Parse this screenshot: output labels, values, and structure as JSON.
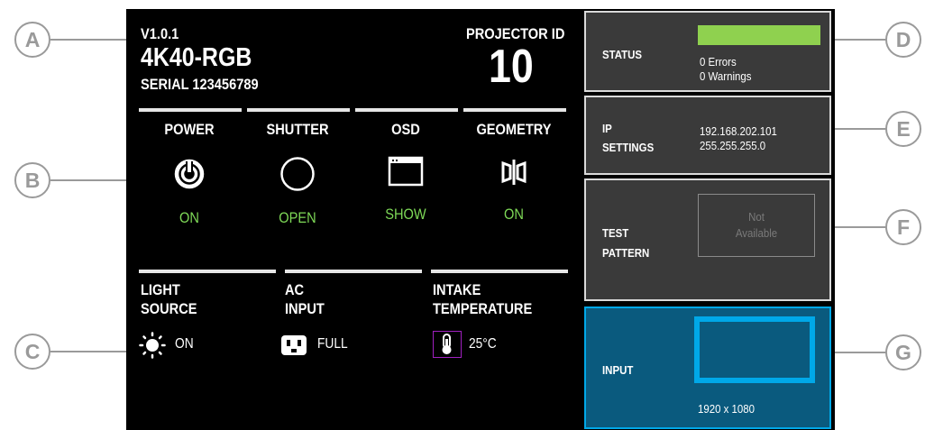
{
  "callouts": [
    "A",
    "B",
    "C",
    "D",
    "E",
    "F",
    "G"
  ],
  "device": {
    "version": "V1.0.1",
    "model": "4K40-RGB",
    "serial": "SERIAL 123456789",
    "projector_id_label": "PROJECTOR ID",
    "projector_id": "10"
  },
  "controls": [
    {
      "title": "POWER",
      "value": "ON",
      "icon": "power-icon"
    },
    {
      "title": "SHUTTER",
      "value": "OPEN",
      "icon": "shutter-icon"
    },
    {
      "title": "OSD",
      "value": "SHOW",
      "icon": "osd-window-icon"
    },
    {
      "title": "GEOMETRY",
      "value": "ON",
      "icon": "geometry-icon"
    }
  ],
  "info": [
    {
      "title_line1": "LIGHT",
      "title_line2": "SOURCE",
      "value": "ON",
      "icon": "sun-icon"
    },
    {
      "title_line1": "AC",
      "title_line2": "INPUT",
      "value": "FULL",
      "icon": "power-plug-icon"
    },
    {
      "title_line1": "INTAKE",
      "title_line2": "TEMPERATURE",
      "value": "25°C",
      "icon": "thermometer-icon"
    }
  ],
  "status": {
    "label": "STATUS",
    "errors": "0 Errors",
    "warnings": "0 Warnings",
    "bar_color": "#8fd14f"
  },
  "ip": {
    "label_line1": "IP",
    "label_line2": "SETTINGS",
    "address": "192.168.202.101",
    "mask": "255.255.255.0"
  },
  "test_pattern": {
    "label_line1": "TEST",
    "label_line2": "PATTERN",
    "button_line1": "Not",
    "button_line2": "Available"
  },
  "input": {
    "label": "INPUT",
    "resolution": "1920 x 1080",
    "accent": "#00a8e8",
    "bg": "#0a5a7e"
  },
  "colors": {
    "on_green": "#7ed957",
    "callout_gray": "#9a9a9a",
    "intake_highlight": "#a020c0"
  }
}
